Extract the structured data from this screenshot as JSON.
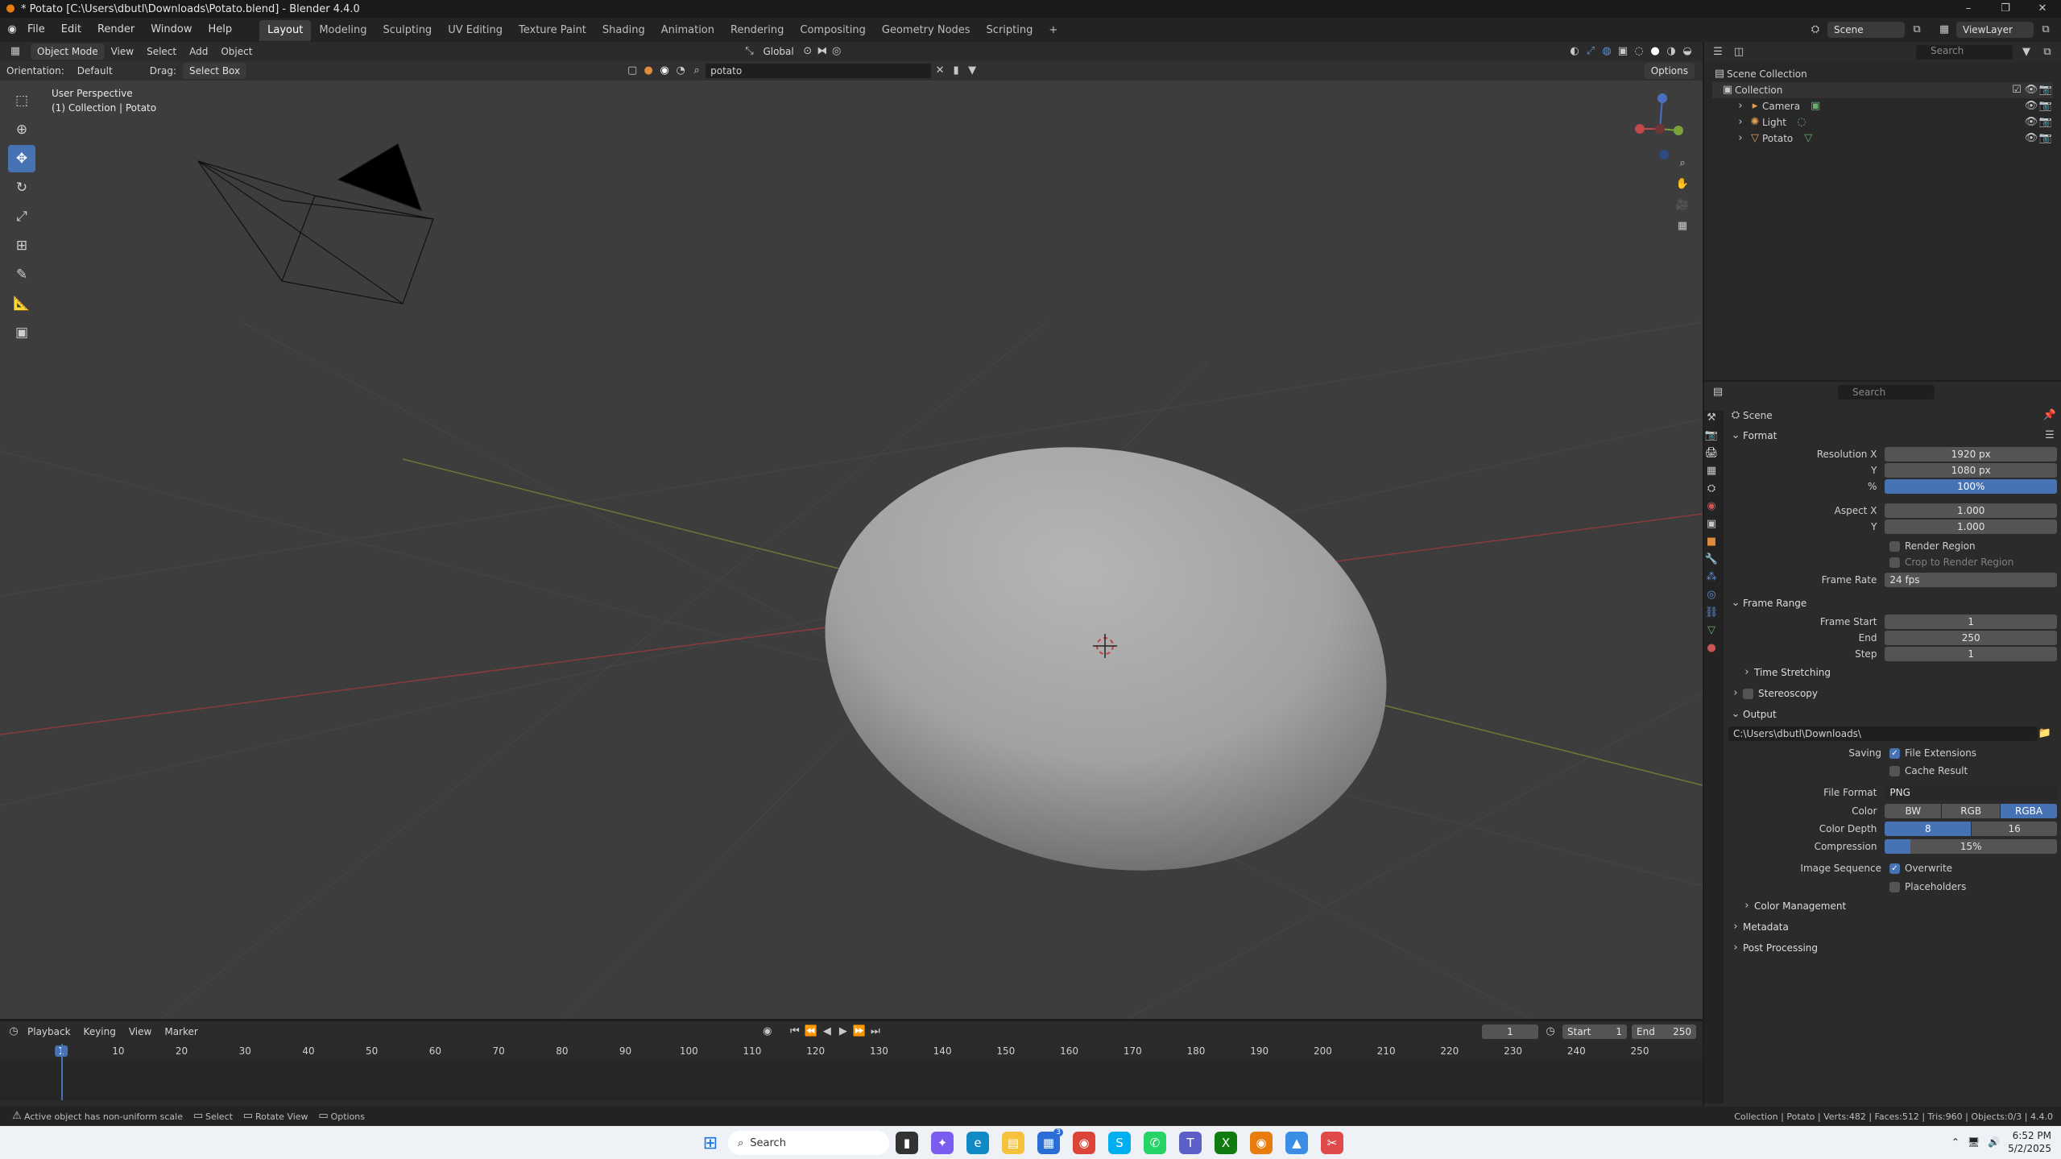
{
  "window": {
    "title": "* Potato [C:\\Users\\dbutl\\Downloads\\Potato.blend] - Blender 4.4.0"
  },
  "menu": {
    "items": [
      "File",
      "Edit",
      "Render",
      "Window",
      "Help"
    ]
  },
  "workspaces": [
    "Layout",
    "Modeling",
    "Sculpting",
    "UV Editing",
    "Texture Paint",
    "Shading",
    "Animation",
    "Rendering",
    "Compositing",
    "Geometry Nodes",
    "Scripting"
  ],
  "active_workspace": "Layout",
  "topright": {
    "scene": "Scene",
    "view_layer": "ViewLayer"
  },
  "viewport_header": {
    "mode": "Object Mode",
    "menus": [
      "View",
      "Select",
      "Add",
      "Object"
    ],
    "transform_orientation": "Global",
    "orientation_label": "Orientation:",
    "orientation_value": "Default",
    "drag_label": "Drag:",
    "drag_value": "Select Box",
    "search_value": "potato",
    "options_label": "Options"
  },
  "viewport": {
    "perspective": "User Perspective",
    "context": "(1) Collection | Potato"
  },
  "outliner": {
    "search_placeholder": "Search",
    "root": "Scene Collection",
    "collection": "Collection",
    "items": [
      "Camera",
      "Light",
      "Potato"
    ]
  },
  "properties": {
    "search_placeholder": "Search",
    "breadcrumb": "Scene",
    "format": {
      "title": "Format",
      "resolution_x_label": "Resolution X",
      "resolution_x": "1920 px",
      "y_label": "Y",
      "resolution_y": "1080 px",
      "pct_label": "%",
      "resolution_pct": "100%",
      "aspect_x_label": "Aspect X",
      "aspect_x": "1.000",
      "aspect_y_label": "Y",
      "aspect_y": "1.000",
      "render_region": "Render Region",
      "crop_region": "Crop to Render Region",
      "frame_rate_label": "Frame Rate",
      "frame_rate": "24 fps"
    },
    "frame_range": {
      "title": "Frame Range",
      "start_label": "Frame Start",
      "start": "1",
      "end_label": "End",
      "end": "250",
      "step_label": "Step",
      "step": "1"
    },
    "time_stretching": "Time Stretching",
    "stereoscopy": "Stereoscopy",
    "output": {
      "title": "Output",
      "path": "C:\\Users\\dbutl\\Downloads\\",
      "saving_label": "Saving",
      "file_extensions": "File Extensions",
      "cache_result": "Cache Result",
      "file_format_label": "File Format",
      "file_format": "PNG",
      "color_label": "Color",
      "color_options": [
        "BW",
        "RGB",
        "RGBA"
      ],
      "color_selected": "RGBA",
      "depth_label": "Color Depth",
      "depth_options": [
        "8",
        "16"
      ],
      "depth_selected": "8",
      "compression_label": "Compression",
      "compression": "15%",
      "compression_fraction": 0.15,
      "image_sequence_label": "Image Sequence",
      "overwrite": "Overwrite",
      "placeholders": "Placeholders"
    },
    "color_management": "Color Management",
    "metadata": "Metadata",
    "post_processing": "Post Processing"
  },
  "timeline": {
    "menus": [
      "Playback",
      "Keying",
      "View",
      "Marker"
    ],
    "current_frame": "1",
    "start_label": "Start",
    "start": "1",
    "end_label": "End",
    "end": "250",
    "ticks": [
      "1",
      "10",
      "20",
      "30",
      "40",
      "50",
      "60",
      "70",
      "80",
      "90",
      "100",
      "110",
      "120",
      "130",
      "140",
      "150",
      "160",
      "170",
      "180",
      "190",
      "200",
      "210",
      "220",
      "230",
      "240",
      "250"
    ]
  },
  "status": {
    "left": "Active object has non-uniform scale",
    "select": "Select",
    "rotate": "Rotate View",
    "options": "Options",
    "right": "Collection | Potato | Verts:482 | Faces:512 | Tris:960 | Objects:0/3 | 4.4.0"
  },
  "taskbar": {
    "search": "Search",
    "time": "6:52 PM",
    "date": "5/2/2025",
    "badge": "3"
  },
  "colors": {
    "accent": "#4772b3",
    "viewport": "#3d3d3d",
    "panel": "#2b2b2b"
  }
}
